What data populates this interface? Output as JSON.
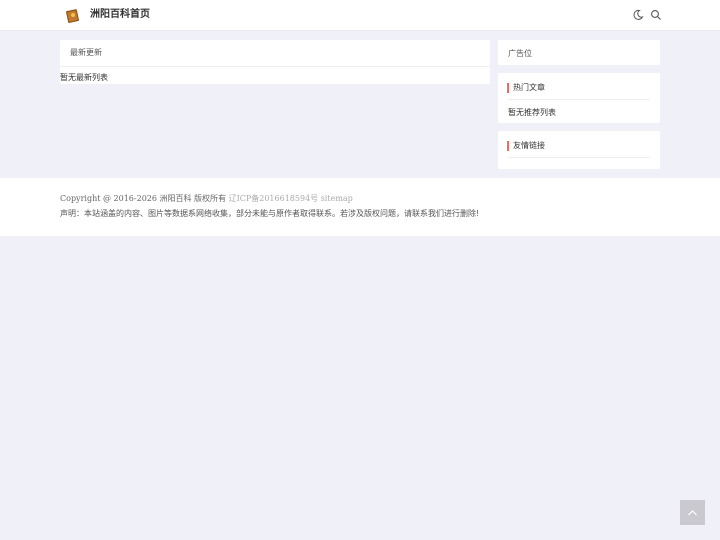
{
  "header": {
    "site_name": "洲阳百科首页",
    "icons": [
      "book-logo-icon",
      "moon-icon",
      "search-icon"
    ]
  },
  "main": {
    "latest_title": "最新更新",
    "latest_empty": "暂无最新列表"
  },
  "sidebar": {
    "ad_title": "广告位",
    "hot_title": "热门文章",
    "hot_empty": "暂无推荐列表",
    "links_title": "友情链接"
  },
  "footer": {
    "copyright": "Copyright @ 2016-2026 洲阳百科 版权所有",
    "icp": "辽ICP备2016618594号",
    "sitemap": "sitemap",
    "disclaimer": "声明：本站涵盖的内容、图片等数据系网络收集，部分未能与原作者取得联系。若涉及版权问题，请联系我们进行删除!"
  },
  "colors": {
    "accent": "#f26b5b",
    "background": "#f0f0f8",
    "backtop": "#c9c9cf"
  }
}
